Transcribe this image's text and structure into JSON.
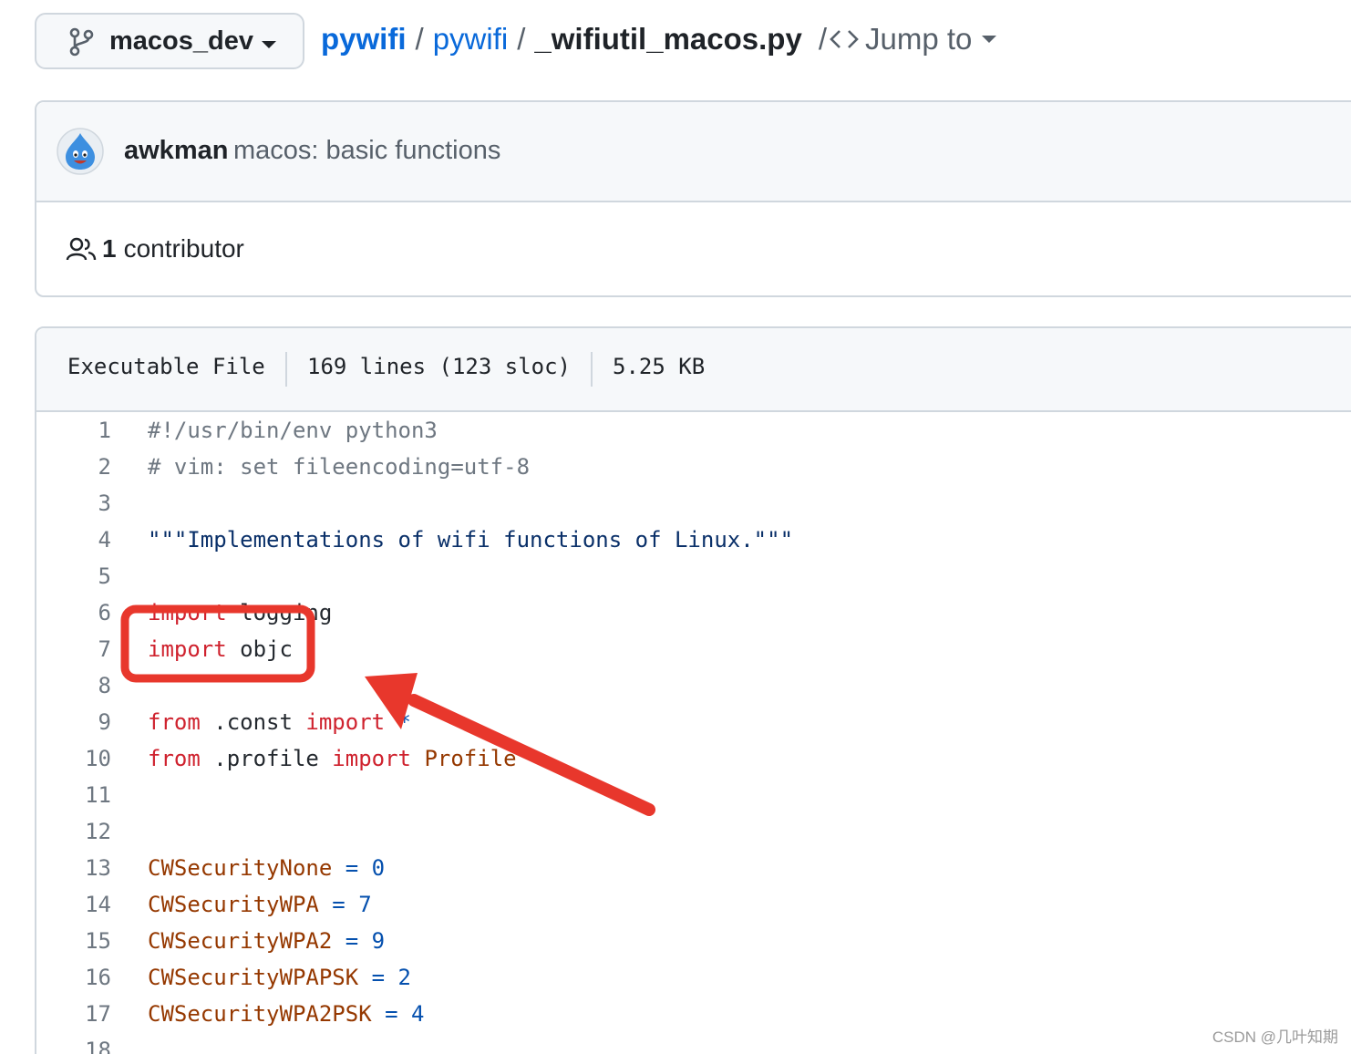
{
  "branch": {
    "name": "macos_dev"
  },
  "breadcrumb": {
    "repo": "pywifi",
    "folder": "pywifi",
    "file": "_wifiutil_macos.py",
    "sep": "/",
    "jump_to": "Jump to"
  },
  "commit": {
    "author": "awkman",
    "message": "macos: basic functions",
    "contributors_count": "1",
    "contributors_label": "contributor"
  },
  "file": {
    "type": "Executable File",
    "lines": "169 lines (123 sloc)",
    "size": "5.25 KB"
  },
  "code": [
    {
      "n": "1",
      "t": "#!/usr/bin/env python3"
    },
    {
      "n": "2",
      "t": "# vim: set fileencoding=utf-8"
    },
    {
      "n": "3",
      "t": ""
    },
    {
      "n": "4",
      "t": "\"\"\"Implementations of wifi functions of Linux.\"\"\""
    },
    {
      "n": "5",
      "t": ""
    },
    {
      "n": "6",
      "t": "import logging"
    },
    {
      "n": "7",
      "t": "import objc"
    },
    {
      "n": "8",
      "t": ""
    },
    {
      "n": "9",
      "t": "from .const import *"
    },
    {
      "n": "10",
      "t": "from .profile import Profile"
    },
    {
      "n": "11",
      "t": ""
    },
    {
      "n": "12",
      "t": ""
    },
    {
      "n": "13",
      "t": "CWSecurityNone = 0"
    },
    {
      "n": "14",
      "t": "CWSecurityWPA = 7"
    },
    {
      "n": "15",
      "t": "CWSecurityWPA2 = 9"
    },
    {
      "n": "16",
      "t": "CWSecurityWPAPSK = 2"
    },
    {
      "n": "17",
      "t": "CWSecurityWPA2PSK = 4"
    },
    {
      "n": "18",
      "t": ""
    }
  ],
  "annotation": {
    "highlight_color": "#e8372c"
  },
  "watermark": "CSDN @几叶知期",
  "icons": [
    "git-branch-icon",
    "caret-down-icon",
    "code-icon",
    "avatar",
    "people-icon"
  ]
}
